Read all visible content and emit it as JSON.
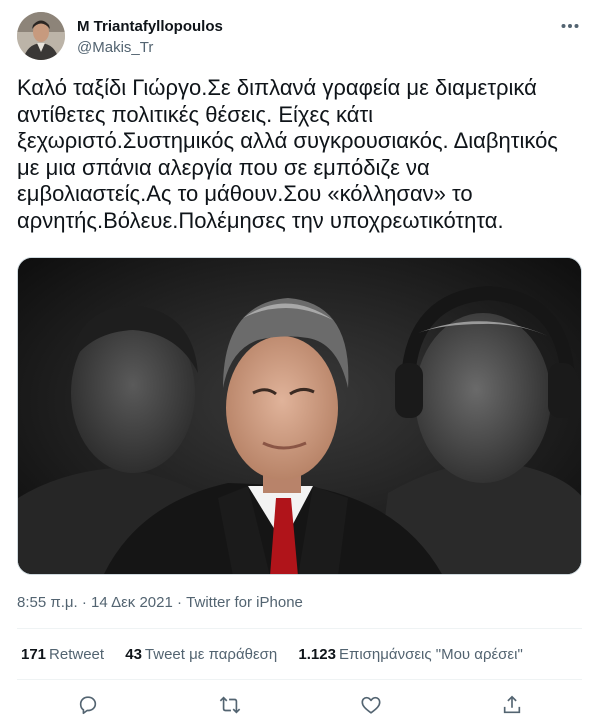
{
  "author": {
    "display_name": "M Triantafyllopoulos",
    "handle": "@Makis_Tr"
  },
  "tweet": {
    "text": "Καλό ταξίδι Γιώργο.Σε διπλανά γραφεία με διαμετρικά αντίθετες πολιτικές θέσεις. Είχες κάτι ξεχωριστό.Συστημικός αλλά συγκρουσιακός. Διαβητικός με μια σπάνια αλεργία που σε εμπόδιζε να εμβολιαστείς.Ας το μάθουν.Σου «κόλλησαν» το αρνητής.Βόλευε.Πολέμησες την υποχρεωτικότητα."
  },
  "meta": {
    "time": "8:55 π.μ.",
    "separator": "·",
    "date": "14 Δεκ 2021",
    "source": "Twitter for iPhone"
  },
  "stats": {
    "retweets_count": "171",
    "retweets_label": "Retweet",
    "quotes_count": "43",
    "quotes_label": "Tweet με παράθεση",
    "likes_count": "1.123",
    "likes_label": "Επισημάνσεις \"Μου αρέσει\""
  },
  "icons": {
    "more": "more-dots-icon",
    "reply": "reply-icon",
    "retweet": "retweet-icon",
    "like": "heart-icon",
    "share": "share-icon"
  },
  "colors": {
    "text_primary": "#0f1419",
    "text_secondary": "#536471",
    "divider": "#eff3f4",
    "icon": "#536471"
  }
}
